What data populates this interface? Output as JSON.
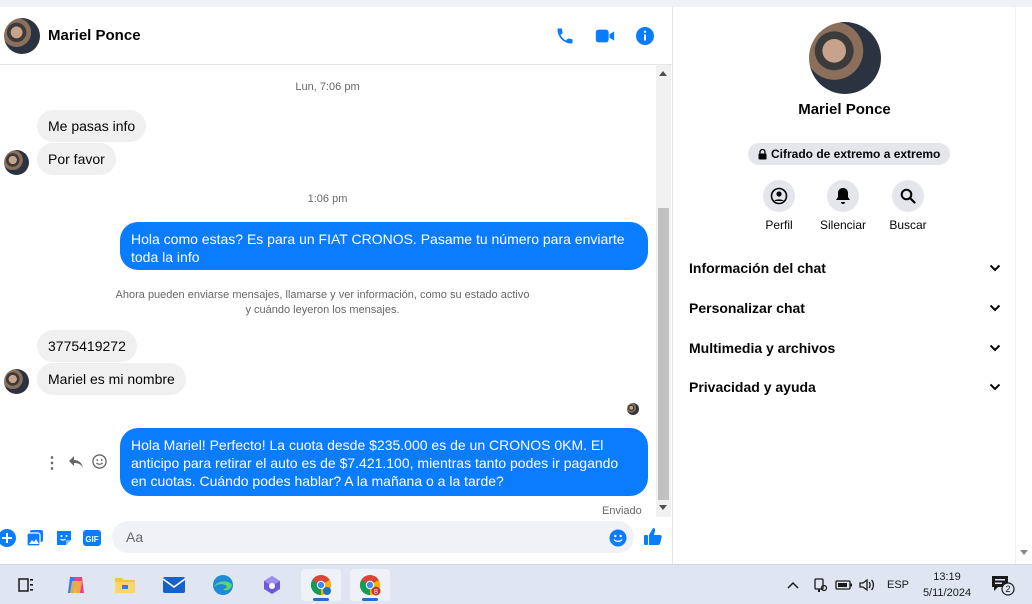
{
  "chat": {
    "contact_name": "Mariel Ponce",
    "header_icons": [
      "phone-icon",
      "video-call-icon",
      "info-icon"
    ],
    "accent_color": "#0a7cff",
    "time_separators": [
      "Lun, 7:06 pm",
      "1:06 pm"
    ],
    "incoming_1": [
      "Me pasas info",
      "Por favor"
    ],
    "outgoing_1": "Hola como estas? Es para un FIAT CRONOS. Pasame tu número para enviarte toda la info",
    "system_notice": [
      "Ahora pueden enviarse mensajes, llamarse y ver información, como su estado activo",
      "y cuándo leyeron los mensajes."
    ],
    "incoming_2": [
      "3775419272",
      "Mariel es mi nombre"
    ],
    "outgoing_2": " Hola Mariel! Perfecto! La cuota desde $235.000 es de un CRONOS 0KM. El anticipo para retirar el auto es de $7.421.100, mientras tanto podes ir pagando en cuotas. Cuándo podes hablar? A la mañana o a la tarde?",
    "sent_status": "Enviado",
    "composer_placeholder": "Aa"
  },
  "details": {
    "name": "Mariel Ponce",
    "encryption_badge": "Cifrado de extremo a extremo",
    "actions": [
      {
        "label": "Perfil",
        "icon": "profile-icon"
      },
      {
        "label": "Silenciar",
        "icon": "bell-icon"
      },
      {
        "label": "Buscar",
        "icon": "search-icon"
      }
    ],
    "sections": [
      "Información del chat",
      "Personalizar chat",
      "Multimedia y archivos",
      "Privacidad y ayuda"
    ]
  },
  "taskbar": {
    "apps": [
      "task-view-icon",
      "copilot-icon",
      "file-explorer-icon",
      "mail-icon",
      "edge-icon",
      "app-icon",
      "chrome-icon",
      "chrome-profile-icon"
    ],
    "language": "ESP",
    "time": "13:19",
    "date": "5/11/2024",
    "notification_count": "2"
  }
}
